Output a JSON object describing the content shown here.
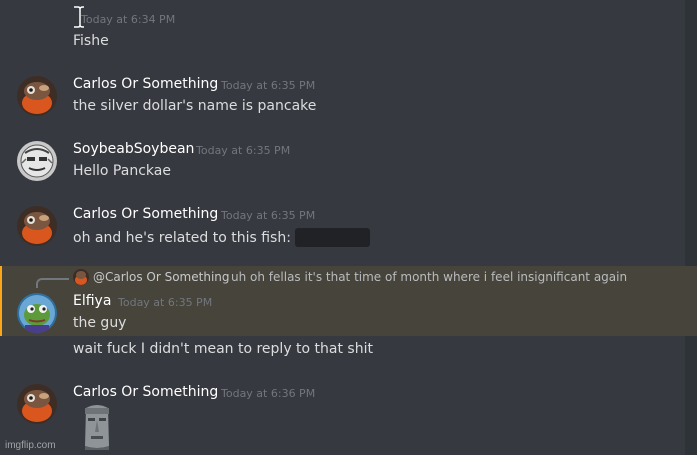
{
  "messages": [
    {
      "timestamp": "Today at 6:34 PM",
      "text": "Fishe"
    },
    {
      "author": "Carlos Or Something",
      "timestamp": "Today at 6:35 PM",
      "text": "the silver dollar's name is pancake"
    },
    {
      "author": "SoybeabSoybean",
      "timestamp": "Today at 6:35 PM",
      "text": "Hello Panckae"
    },
    {
      "author": "Carlos Or Something",
      "timestamp": "Today at 6:35 PM",
      "text": "oh and he's related to this fish:"
    },
    {
      "author": "Elfiya",
      "timestamp": "Today at 6:35 PM",
      "text": "the guy",
      "reply": {
        "author": "@Carlos Or Something",
        "text": "uh oh fellas it's that time of month where i feel insignificant again"
      }
    },
    {
      "text": "wait fuck I didn't mean to reply to that shit"
    },
    {
      "author": "Carlos Or Something",
      "timestamp": "Today at 6:36 PM",
      "emoji": "moai-emoji"
    }
  ],
  "watermark": "imgflip.com",
  "colors": {
    "background": "#36393f",
    "highlight": "#47443b",
    "mention_border": "#faa81a",
    "username": "#ffffff",
    "text": "#dcddde",
    "timestamp": "#72767d"
  }
}
